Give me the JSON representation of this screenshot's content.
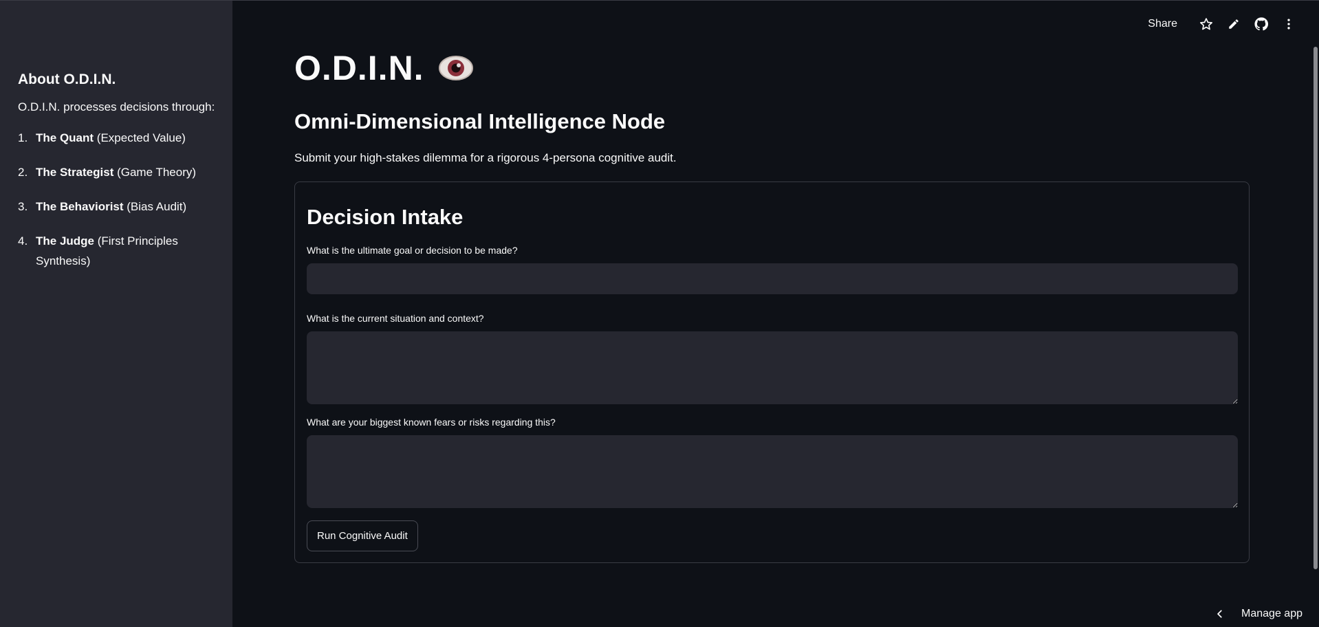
{
  "sidebar": {
    "title": "About O.D.I.N.",
    "intro": "O.D.I.N. processes decisions through:",
    "items": [
      {
        "num": "1.",
        "bold": "The Quant",
        "rest": " (Expected Value)"
      },
      {
        "num": "2.",
        "bold": "The Strategist",
        "rest": " (Game Theory)"
      },
      {
        "num": "3.",
        "bold": "The Behaviorist",
        "rest": " (Bias Audit)"
      },
      {
        "num": "4.",
        "bold": "The Judge",
        "rest": " (First Principles Synthesis)"
      }
    ]
  },
  "toolbar": {
    "share_label": "Share",
    "icons": [
      "star-icon",
      "pencil-icon",
      "github-icon",
      "more-vertical-icon"
    ]
  },
  "main": {
    "title": "O.D.I.N.",
    "title_icon": "eye-icon",
    "subtitle": "Omni-Dimensional Intelligence Node",
    "description": "Submit your high-stakes dilemma for a rigorous 4-persona cognitive audit.",
    "form": {
      "title": "Decision Intake",
      "fields": [
        {
          "label": "What is the ultimate goal or decision to be made?",
          "value": ""
        },
        {
          "label": "What is the current situation and context?",
          "value": ""
        },
        {
          "label": "What are your biggest known fears or risks regarding this?",
          "value": ""
        }
      ],
      "submit_label": "Run Cognitive Audit"
    }
  },
  "footer": {
    "manage_label": "Manage app"
  },
  "colors": {
    "background": "#0e1117",
    "sidebar": "#262730",
    "input": "#262730",
    "text": "#fafafa",
    "border": "#3a3c45"
  }
}
